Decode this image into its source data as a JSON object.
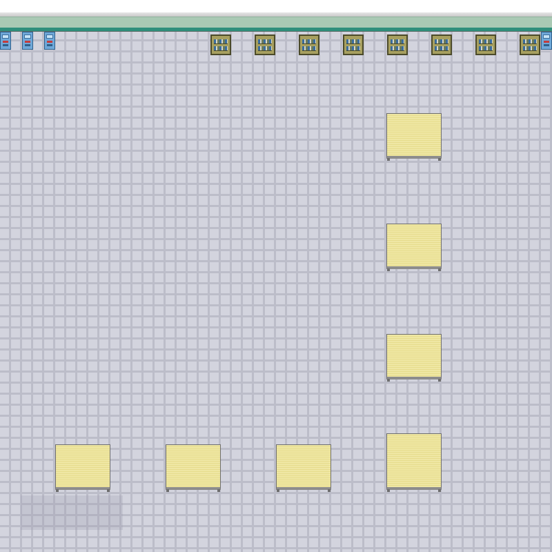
{
  "scene": {
    "type": "top-down tile room",
    "colors": {
      "floor": "#d3d4de",
      "grout": "#bcbdc9",
      "wall_band": "#a9c9b4",
      "wall_edge": "#2f8f7c",
      "table_top": "#efe7a4",
      "machine_body": "#6fa8d8",
      "shelf_body": "#a7a060"
    },
    "objects": {
      "machines": [
        {
          "icon": "vending-machine-icon"
        },
        {
          "icon": "vending-machine-icon"
        },
        {
          "icon": "vending-machine-icon"
        },
        {
          "icon": "vending-machine-icon"
        }
      ],
      "bookshelves": 8,
      "tables": 7
    }
  }
}
